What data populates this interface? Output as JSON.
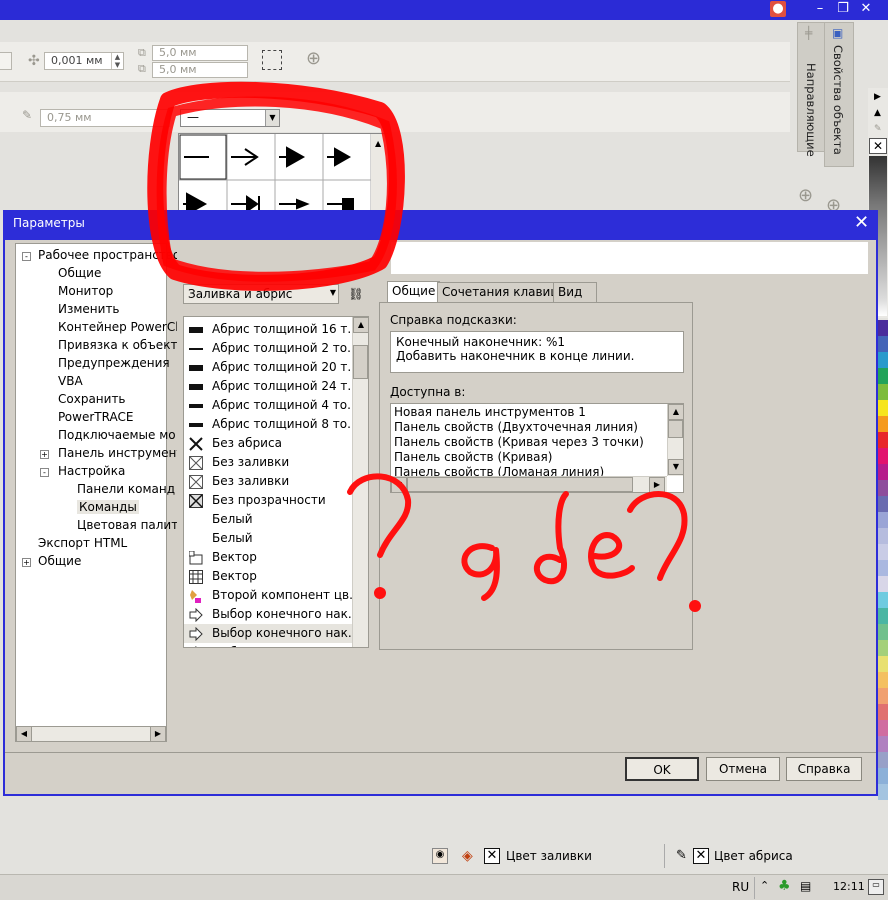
{
  "toolbar": {
    "nudge_value": "0,001 мм",
    "dup_x": "5,0 мм",
    "dup_y": "5,0 мм",
    "outline_width": "0,75 мм",
    "line_style": "—"
  },
  "docker": {
    "guides_label": "Направляющие",
    "object_props_label": "Свойства объекта"
  },
  "dialog": {
    "title": "Параметры",
    "tree": [
      {
        "label": "Рабочее пространство",
        "level": 0,
        "expander": "-"
      },
      {
        "label": "Общие",
        "level": 1
      },
      {
        "label": "Монитор",
        "level": 1
      },
      {
        "label": "Изменить",
        "level": 1
      },
      {
        "label": "Контейнер PowerCli",
        "level": 1
      },
      {
        "label": "Привязка к объекта",
        "level": 1
      },
      {
        "label": "Предупреждения",
        "level": 1
      },
      {
        "label": "VBA",
        "level": 1
      },
      {
        "label": "Сохранить",
        "level": 1
      },
      {
        "label": "PowerTRACE",
        "level": 1
      },
      {
        "label": "Подключаемые мо",
        "level": 1
      },
      {
        "label": "Панель инструмент",
        "level": 1,
        "expander": "+"
      },
      {
        "label": "Настройка",
        "level": 1,
        "expander": "-"
      },
      {
        "label": "Панели команд",
        "level": 2
      },
      {
        "label": "Команды",
        "level": 2,
        "selected": true
      },
      {
        "label": "Цветовая палитр",
        "level": 2
      },
      {
        "label": "Экспорт HTML",
        "level": 0
      },
      {
        "label": "Общие",
        "level": 0,
        "expander": "+"
      }
    ],
    "category_select": "Заливка и абрис",
    "commands": [
      {
        "label": "Абрис толщиной 16 т...",
        "icon": "thick-line-icon"
      },
      {
        "label": "Абрис толщиной 2 то...",
        "icon": "thin-line-icon"
      },
      {
        "label": "Абрис толщиной 20 т...",
        "icon": "thick-line-icon"
      },
      {
        "label": "Абрис толщиной 24 т...",
        "icon": "thick-line-icon"
      },
      {
        "label": "Абрис толщиной 4 то...",
        "icon": "medium-line-icon"
      },
      {
        "label": "Абрис толщиной 8 то...",
        "icon": "medium-line-icon"
      },
      {
        "label": "Без абриса",
        "icon": "x-icon"
      },
      {
        "label": "Без заливки",
        "icon": "crossed-box-icon"
      },
      {
        "label": "Без заливки",
        "icon": "crossed-box-icon"
      },
      {
        "label": "Без прозрачности",
        "icon": "crossed-dark-box-icon"
      },
      {
        "label": "Белый",
        "icon": "blank-icon"
      },
      {
        "label": "Белый",
        "icon": "blank-icon"
      },
      {
        "label": "Вектор",
        "icon": "vector-icon"
      },
      {
        "label": "Вектор",
        "icon": "grid-icon"
      },
      {
        "label": "Второй компонент цв...",
        "icon": "color-component-icon"
      },
      {
        "label": "Выбор конечного нак...",
        "icon": "arrow-outline-icon"
      },
      {
        "label": "Выбор конечного нак...",
        "icon": "arrow-outline-icon",
        "selected": true
      },
      {
        "label": "Выбо...",
        "icon": "arrow-outline-icon"
      }
    ],
    "tabs": [
      "Общие",
      "Сочетания клавиш",
      "Вид"
    ],
    "tooltip_help_label": "Справка подсказки:",
    "tooltip_help_lines": [
      "Конечный наконечник: %1",
      "Добавить наконечник в конце линии."
    ],
    "available_in_label": "Доступна в:",
    "available_in_items": [
      "Новая панель инструментов 1",
      "Панель свойств (Двухточечная линия)",
      "Панель свойств (Кривая через 3 точки)",
      "Панель свойств (Кривая)",
      "Панель свойств (Ломаная линия)"
    ],
    "ok": "OK",
    "cancel": "Отмена",
    "help": "Справка"
  },
  "statusbar": {
    "fill_color": "Цвет заливки",
    "outline_color": "Цвет абриса"
  },
  "taskbar": {
    "lang": "RU",
    "time": "12:11"
  },
  "annotation": {
    "handwritten": "?где?"
  },
  "palette_colors": [
    "#4b2c9c",
    "#4464b8",
    "#2a9acc",
    "#22a35a",
    "#7cbc3c",
    "#f6e51e",
    "#f59a1e",
    "#e8262b",
    "#e2136e",
    "#b61c8b",
    "#8e4d9c",
    "#6a6bb0",
    "#9aa4d6",
    "#b6bcde",
    "#c9cce6",
    "#aab8e0",
    "#d8d6e8",
    "#6fcbe0",
    "#4ab6a3",
    "#70c08c",
    "#a4d07a",
    "#e8e070",
    "#f4c060",
    "#f0a070",
    "#e07070",
    "#d06ca0",
    "#b080c0",
    "#98a0c8",
    "#8cb0d8",
    "#a4c4e0"
  ]
}
